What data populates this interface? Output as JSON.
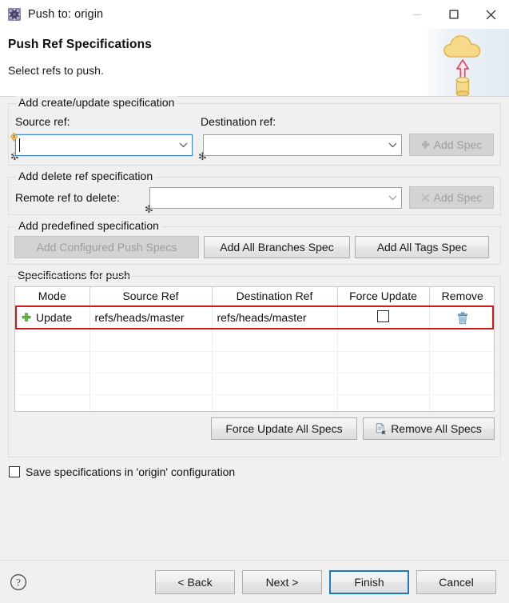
{
  "window": {
    "title": "Push to: origin",
    "icon": "repository-gear-icon",
    "controls": {
      "minimize": "minimize",
      "maximize": "maximize",
      "close": "close"
    }
  },
  "header": {
    "title": "Push Ref Specifications",
    "subtitle": "Select refs to push.",
    "art": "push-to-cloud-icon"
  },
  "create_update_group": {
    "title": "Add create/update specification",
    "source_label": "Source ref:",
    "destination_label": "Destination ref:",
    "source_value": "",
    "source_placeholder": "",
    "destination_value": "",
    "destination_placeholder": "",
    "add_spec_label": "Add Spec",
    "add_spec_enabled": false
  },
  "delete_group": {
    "title": "Add delete ref specification",
    "remote_label": "Remote ref to delete:",
    "remote_value": "",
    "remote_placeholder": "",
    "add_spec_label": "Add Spec",
    "add_spec_enabled": false
  },
  "predefined_group": {
    "title": "Add predefined specification",
    "buttons": [
      {
        "label": "Add Configured Push Specs",
        "enabled": false
      },
      {
        "label": "Add All Branches Spec",
        "enabled": true
      },
      {
        "label": "Add All Tags Spec",
        "enabled": true
      }
    ]
  },
  "specs_group": {
    "title": "Specifications for push",
    "columns": [
      "Mode",
      "Source Ref",
      "Destination Ref",
      "Force Update",
      "Remove"
    ],
    "rows": [
      {
        "mode": "Update",
        "mode_icon": "add-green-plus-icon",
        "source_ref": "refs/heads/master",
        "destination_ref": "refs/heads/master",
        "force_update": false,
        "remove_icon": "trash-icon",
        "highlighted": true
      }
    ],
    "empty_row_count": 4,
    "force_update_all_label": "Force Update All Specs",
    "remove_all_label": "Remove All Specs"
  },
  "save_option": {
    "label": "Save specifications in 'origin' configuration",
    "checked": false
  },
  "footer": {
    "help_icon": "help-question-icon",
    "buttons": [
      {
        "label": "< Back",
        "default": false
      },
      {
        "label": "Next >",
        "default": false
      },
      {
        "label": "Finish",
        "default": true
      },
      {
        "label": "Cancel",
        "default": false
      }
    ]
  },
  "colors": {
    "highlight_red": "#d11a1a",
    "focus_blue": "#3d8ac7",
    "default_button_blue": "#1a7dc4",
    "cloud_yellow": "#f5d372",
    "arrow_red": "#e8506b",
    "trash_blue": "#6ea9c4",
    "plus_green": "#53b03a"
  }
}
